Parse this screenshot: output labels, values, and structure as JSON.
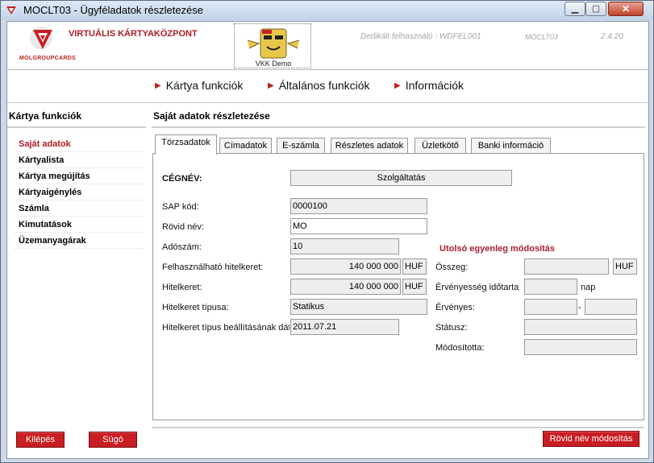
{
  "window": {
    "title": "MOCLT03 - Ügyféladatok részletezése",
    "min": "▁",
    "max": "▢",
    "close": "✕"
  },
  "header": {
    "app_title": "VIRTUÁLIS KÁRTYAKÖZPONT",
    "brand": "MOLGROUPCARDS",
    "mascot_label": "VKK Demo",
    "user_info": "Dedikált felhasználó : WDFEL001",
    "screen_code": "MOCLT03",
    "version": "2.4.20"
  },
  "nav": [
    {
      "label": "Kártya funkciók"
    },
    {
      "label": "Általános funkciók"
    },
    {
      "label": "Információk"
    }
  ],
  "left": {
    "heading": "Kártya funkciók",
    "items": [
      {
        "label": "Saját adatok"
      },
      {
        "label": "Kártyalista"
      },
      {
        "label": "Kártya megújítás"
      },
      {
        "label": "Kártyaigénylés"
      },
      {
        "label": "Számla"
      },
      {
        "label": "Kimutatások"
      },
      {
        "label": "Üzemanyagárak"
      }
    ],
    "exit_button": "Kilépés",
    "help_button": "Súgó"
  },
  "main": {
    "heading": "Saját adatok részletezése",
    "tabs": [
      {
        "label": "Törzsadatok"
      },
      {
        "label": "Címadatok"
      },
      {
        "label": "E-számla"
      },
      {
        "label": "Részletes adatok"
      },
      {
        "label": "Üzletkötő"
      },
      {
        "label": "Banki információ"
      }
    ],
    "form": {
      "company_label": "CÉGNÉV:",
      "company_value": "Szolgáltatás",
      "sap_label": "SAP kód:",
      "sap_value": "0000100",
      "short_name_label": "Rövid név:",
      "short_name_value": "MO",
      "tax_label": "Adószám:",
      "tax_value": "10",
      "avail_credit_label": "Felhasználható hitelkeret:",
      "avail_credit_value": "140 000 000",
      "avail_credit_currency": "HUF",
      "credit_label": "Hitelkeret:",
      "credit_value": "140 000 000",
      "credit_currency": "HUF",
      "credit_type_label": "Hitelkeret típusa:",
      "credit_type_value": "Statikus",
      "credit_type_date_label": "Hitelkeret típus beállításának dátu",
      "credit_type_date_value": "2011.07.21"
    },
    "balance": {
      "title": "Utolsó egyenleg módosítás",
      "amount_label": "Összeg:",
      "amount_value": "",
      "amount_currency": "HUF",
      "validity_period_label": "Érvényesség időtarta",
      "validity_period_value": "",
      "validity_unit": "nap",
      "valid_label": "Érvényes:",
      "valid_from": "",
      "valid_sep": "-",
      "valid_to": "",
      "status_label": "Státusz:",
      "status_value": "",
      "modified_by_label": "Módosította:",
      "modified_by_value": ""
    },
    "modify_button": "Rövid név módosítás"
  }
}
